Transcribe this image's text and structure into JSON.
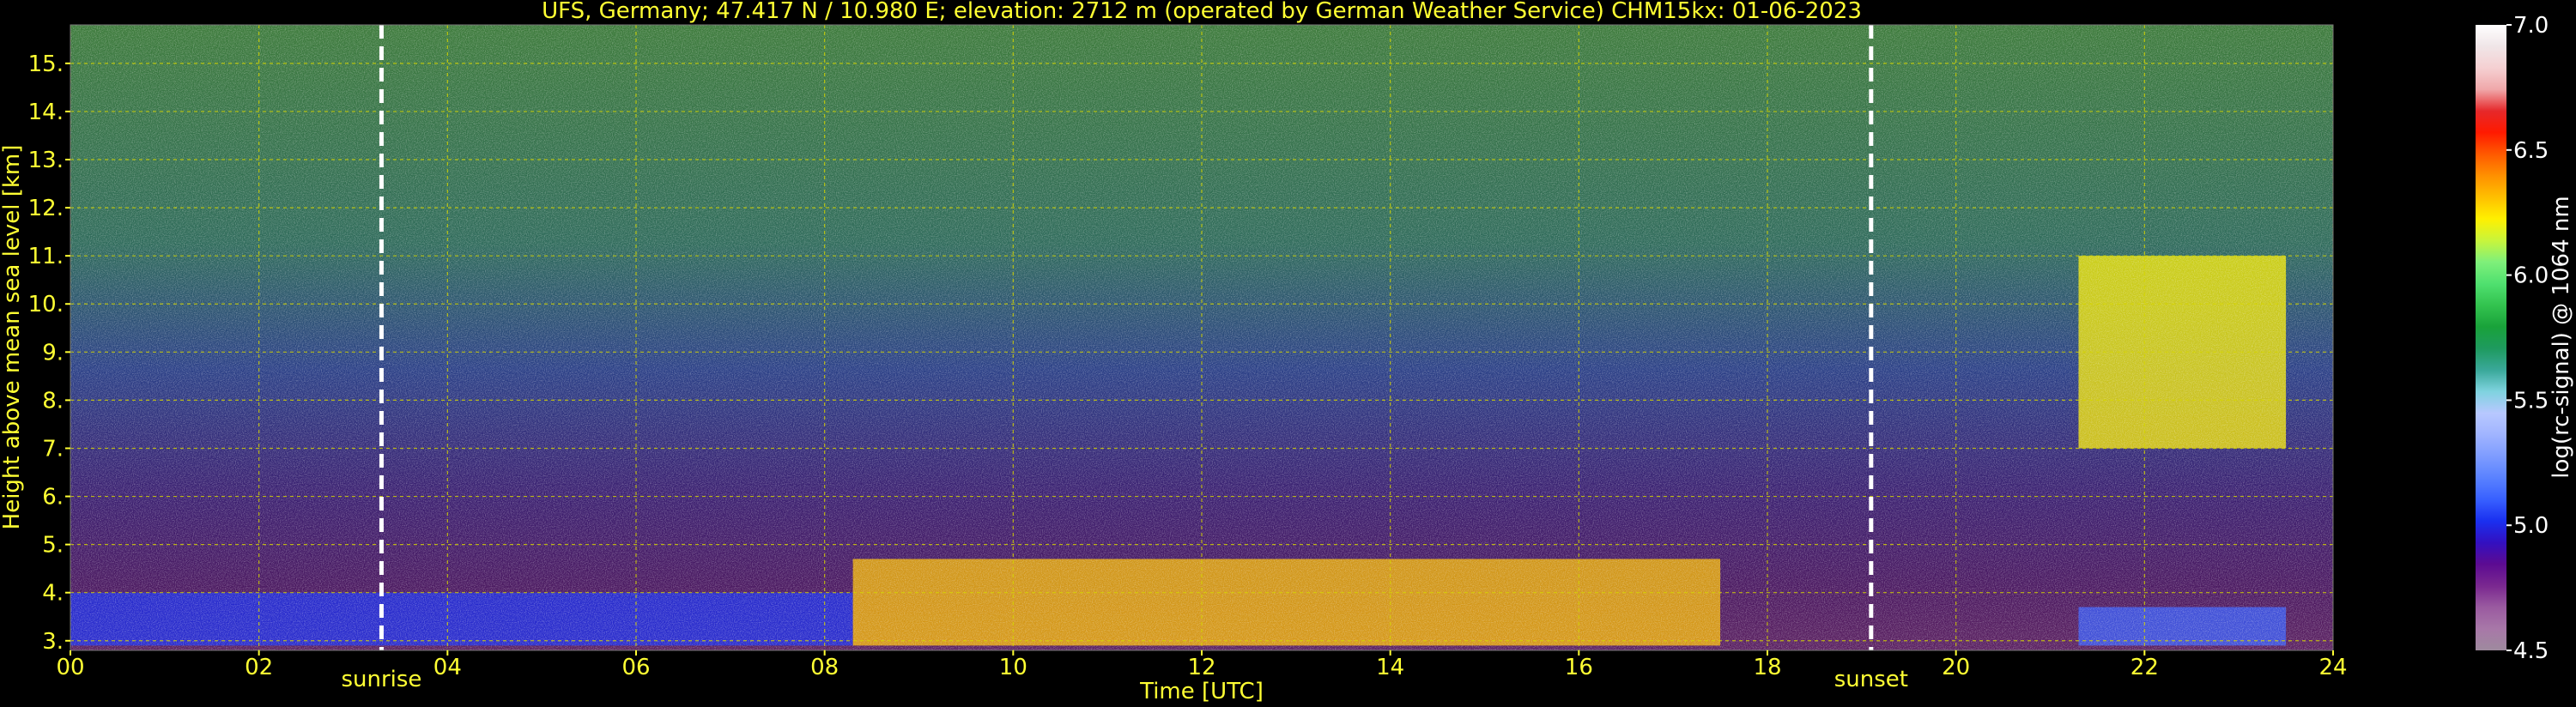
{
  "chart_data": {
    "type": "heatmap",
    "title": "UFS, Germany; 47.417 N / 10.980 E; elevation: 2712 m  (operated by German Weather Service)    CHM15kx: 01-06-2023",
    "xlabel": "Time [UTC]",
    "ylabel": "Height above mean sea level [km]",
    "xlim": [
      0,
      24
    ],
    "ylim": [
      2.8,
      15.8
    ],
    "x_ticks": [
      {
        "value": 0,
        "label": "00"
      },
      {
        "value": 2,
        "label": "02"
      },
      {
        "value": 4,
        "label": "04"
      },
      {
        "value": 6,
        "label": "06"
      },
      {
        "value": 8,
        "label": "08"
      },
      {
        "value": 10,
        "label": "10"
      },
      {
        "value": 12,
        "label": "12"
      },
      {
        "value": 14,
        "label": "14"
      },
      {
        "value": 16,
        "label": "16"
      },
      {
        "value": 18,
        "label": "18"
      },
      {
        "value": 20,
        "label": "20"
      },
      {
        "value": 22,
        "label": "22"
      },
      {
        "value": 24,
        "label": "24"
      }
    ],
    "y_ticks": [
      {
        "value": 3,
        "label": "3."
      },
      {
        "value": 4,
        "label": "4."
      },
      {
        "value": 5,
        "label": "5."
      },
      {
        "value": 6,
        "label": "6."
      },
      {
        "value": 7,
        "label": "7."
      },
      {
        "value": 8,
        "label": "8."
      },
      {
        "value": 9,
        "label": "9."
      },
      {
        "value": 10,
        "label": "10."
      },
      {
        "value": 11,
        "label": "11."
      },
      {
        "value": 12,
        "label": "12."
      },
      {
        "value": 13,
        "label": "13."
      },
      {
        "value": 14,
        "label": "14."
      },
      {
        "value": 15,
        "label": "15."
      }
    ],
    "grid": true,
    "annotations": [
      {
        "name": "sunrise",
        "label": "sunrise",
        "x": 3.3
      },
      {
        "name": "sunset",
        "label": "sunset",
        "x": 19.1
      }
    ],
    "colorbar": {
      "label": "log(rc-signal) @ 1064 nm",
      "range": [
        4.5,
        7.0
      ],
      "ticks": [
        {
          "value": 4.5,
          "label": "4.5"
        },
        {
          "value": 5.0,
          "label": "5.0"
        },
        {
          "value": 5.5,
          "label": "5.5"
        },
        {
          "value": 6.0,
          "label": "6.0"
        },
        {
          "value": 6.5,
          "label": "6.5"
        },
        {
          "value": 7.0,
          "label": "7.0"
        }
      ],
      "colors": [
        "#9e8a9e",
        "#a878a8",
        "#9a5aa0",
        "#7a2890",
        "#5c0b92",
        "#3310c0",
        "#1a30f0",
        "#3860ff",
        "#5a82ff",
        "#7e9cff",
        "#a0b4ff",
        "#b8c8ff",
        "#7fd3df",
        "#3aa89a",
        "#1e9a5e",
        "#19a23a",
        "#33c34f",
        "#4fe06f",
        "#7ff07a",
        "#c8f53c",
        "#fff000",
        "#ffc000",
        "#ff9000",
        "#ff5a00",
        "#ff1a00",
        "#e6282a",
        "#f0a8aa",
        "#f5d0d2",
        "#f0e6e8",
        "#ffffff"
      ]
    },
    "features": [
      {
        "name": "residual-layer",
        "t_range": [
          0,
          8.3
        ],
        "h_range": [
          2.9,
          4.0
        ],
        "value": 5.0
      },
      {
        "name": "low-cloud-layer",
        "t_range": [
          8.3,
          17.5
        ],
        "h_range": [
          2.9,
          4.7
        ],
        "value": 6.3
      },
      {
        "name": "cirrus-cloud",
        "t_range": [
          21.3,
          23.5
        ],
        "h_range": [
          7.0,
          11.0
        ],
        "value": 6.2
      },
      {
        "name": "evening-surface-layer",
        "t_range": [
          21.3,
          23.5
        ],
        "h_range": [
          2.9,
          3.7
        ],
        "value": 5.1
      }
    ]
  }
}
